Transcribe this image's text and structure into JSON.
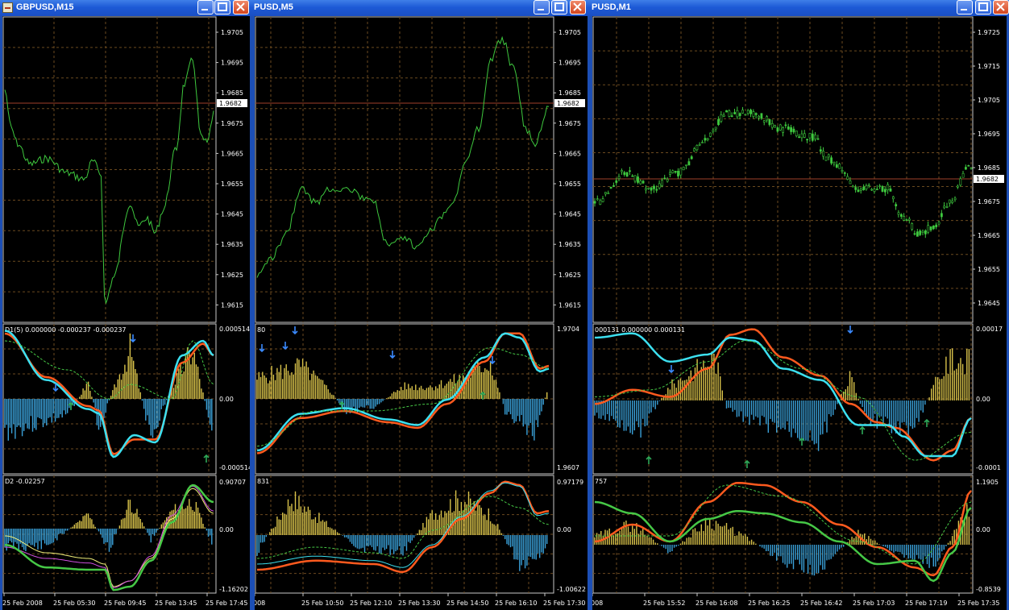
{
  "colors": {
    "price": "#3ec83e",
    "grid": "#6b4a1f",
    "pos": "#d8c24a",
    "neg": "#3aa0d8",
    "red": "#ff5a1e",
    "cyan": "#3ce0f0",
    "green": "#46c846",
    "yellow": "#f0f07a",
    "magenta": "#d050e0",
    "hline": "#a0402a"
  },
  "windows": [
    {
      "title": "GBPUSD,M15",
      "price_ticks": [
        "1.9705",
        "1.9695",
        "1.9685",
        "1.9675",
        "1.9665",
        "1.9655",
        "1.9645",
        "1.9635",
        "1.9625",
        "1.9615"
      ],
      "current": "1.9682",
      "ind1": {
        "label": "D1(5) 0.000000 -0.000237 -0.000237",
        "top": "0.000514",
        "mid": "0.00",
        "bot": "-0.000514"
      },
      "ind2": {
        "label": "D2 -0.02257",
        "top": "0.90707",
        "mid": "0.00",
        "bot": "-1.16202"
      },
      "time_ticks": [
        "25 Feb 2008",
        "25 Feb 05:30",
        "25 Feb 09:45",
        "25 Feb 13:45",
        "25 Feb 17:45"
      ]
    },
    {
      "title": "PUSD,M5",
      "price_ticks": [
        "1.9705",
        "1.9695",
        "1.9685",
        "1.9675",
        "1.9665",
        "1.9655",
        "1.9645",
        "1.9635",
        "1.9625",
        "1.9615"
      ],
      "current": "1.9682",
      "ind1": {
        "label": "80",
        "top": "1.9704",
        "mid": "",
        "bot": "1.9607"
      },
      "ind2": {
        "label": "831",
        "top": "0.97179",
        "mid": "0.00",
        "bot": "-1.00622"
      },
      "time_ticks": [
        "008",
        "25 Feb 10:50",
        "25 Feb 12:10",
        "25 Feb 13:30",
        "25 Feb 14:50",
        "25 Feb 16:10",
        "25 Feb 17:30"
      ]
    },
    {
      "title": "PUSD,M1",
      "price_ticks": [
        "1.9725",
        "1.9715",
        "1.9705",
        "1.9695",
        "1.9685",
        "1.9675",
        "1.9665",
        "1.9655",
        "1.9645"
      ],
      "current": "1.9682",
      "ind1": {
        "label": "000131 0.000000 0.000131",
        "top": "0.00017",
        "mid": "0.00",
        "bot": "-0.0001"
      },
      "ind2": {
        "label": "757",
        "top": "1.1905",
        "mid": "0.00",
        "bot": "-0.8539"
      },
      "time_ticks": [
        "008",
        "25 Feb 15:52",
        "25 Feb 16:08",
        "25 Feb 16:25",
        "25 Feb 16:42",
        "25 Feb 17:03",
        "25 Feb 17:19",
        "25 Feb 17:35"
      ]
    }
  ],
  "icons": {
    "minimize": "minimize-icon",
    "maximize": "maximize-icon",
    "close": "close-icon"
  }
}
